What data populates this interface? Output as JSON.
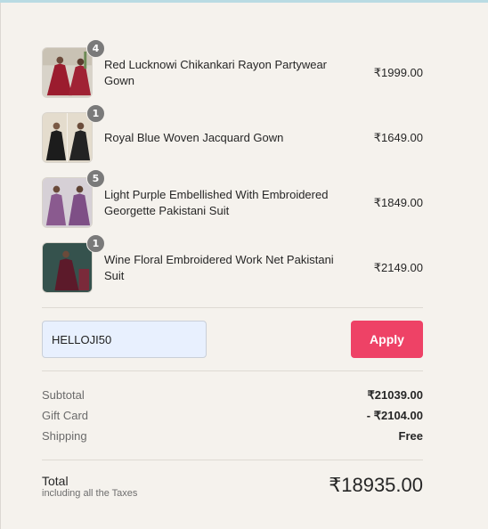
{
  "cart": {
    "items": [
      {
        "name": "Red Lucknowi Chikankari Rayon Partywear Gown",
        "price": "₹1999.00",
        "quantity": "4",
        "image_color": "#9b1c2e"
      },
      {
        "name": "Royal Blue Woven Jacquard Gown",
        "price": "₹1649.00",
        "quantity": "1",
        "image_color": "#1c1c1c"
      },
      {
        "name": "Light Purple Embellished With Embroidered Georgette Pakistani Suit",
        "price": "₹1849.00",
        "quantity": "5",
        "image_color": "#8a5a8f"
      },
      {
        "name": "Wine Floral Embroidered Work Net Pakistani Suit",
        "price": "₹2149.00",
        "quantity": "1",
        "image_color": "#5c1a2a"
      }
    ]
  },
  "discount": {
    "code_value": "HELLOJI50",
    "apply_label": "Apply"
  },
  "summary": {
    "subtotal_label": "Subtotal",
    "subtotal_value": "₹21039.00",
    "giftcard_label": "Gift Card",
    "giftcard_value": "- ₹2104.00",
    "shipping_label": "Shipping",
    "shipping_value": "Free",
    "total_label": "Total",
    "total_sublabel": "including all the Taxes",
    "total_value": "₹18935.00"
  },
  "colors": {
    "background": "#f5f2ed",
    "accent": "#ee4266",
    "input_bg": "#e8f0fe"
  }
}
